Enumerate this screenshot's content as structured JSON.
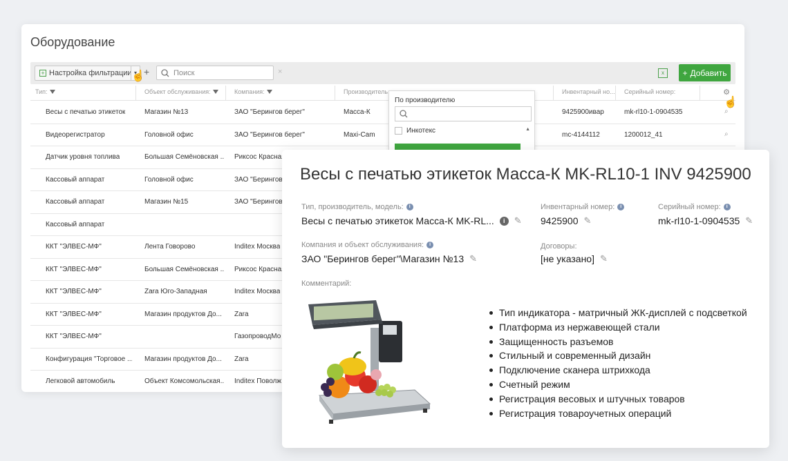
{
  "back": {
    "title": "Оборудование",
    "toolbar": {
      "filter_label": "Настройка фильтрации",
      "drop_glyph": "▾",
      "plus_glyph": "+",
      "search_placeholder": "Поиск",
      "clear_glyph": "×",
      "add_label": "Добавить",
      "add_glyph": "+",
      "excel_glyph": "x"
    },
    "columns": [
      "Тип:",
      "Объект обслуживания:",
      "Компания:",
      "Производитель:",
      "Инвентарный но...",
      "Серийный номер:"
    ],
    "rows": [
      {
        "type": "Весы с печатью этикеток",
        "object": "Магазин №13",
        "company": "ЗАО \"Берингов берег\"",
        "maker": "Масса-К",
        "inv": "9425900ивар",
        "serial": "mk-rl10-1-0904535"
      },
      {
        "type": "Видеорегистратор",
        "object": "Головной офис",
        "company": "ЗАО \"Берингов берег\"",
        "maker": "Maxi-Cam",
        "inv": "mc-4144112",
        "serial": "1200012_41"
      },
      {
        "type": "Датчик уровня топлива",
        "object": "Большая Семёновская ...",
        "company": "Риксос Красная",
        "maker": "",
        "inv": "",
        "serial": ""
      },
      {
        "type": "Кассовый аппарат",
        "object": "Головной офис",
        "company": "ЗАО \"Берингов",
        "maker": "",
        "inv": "",
        "serial": ""
      },
      {
        "type": "Кассовый аппарат",
        "object": "Магазин №15",
        "company": "ЗАО \"Берингов",
        "maker": "",
        "inv": "",
        "serial": ""
      },
      {
        "type": "Кассовый аппарат",
        "object": "",
        "company": "",
        "maker": "",
        "inv": "",
        "serial": ""
      },
      {
        "type": "ККТ \"ЭЛВЕС-МФ\"",
        "object": "Лента Говорово",
        "company": "Inditex Москва",
        "maker": "",
        "inv": "",
        "serial": ""
      },
      {
        "type": "ККТ \"ЭЛВЕС-МФ\"",
        "object": "Большая Семёновская ...",
        "company": "Риксос Красная",
        "maker": "",
        "inv": "",
        "serial": ""
      },
      {
        "type": "ККТ \"ЭЛВЕС-МФ\"",
        "object": "Zara Юго-Западная",
        "company": "Inditex Москва",
        "maker": "",
        "inv": "",
        "serial": ""
      },
      {
        "type": "ККТ \"ЭЛВЕС-МФ\"",
        "object": "Магазин продуктов До...",
        "company": "Zara",
        "maker": "",
        "inv": "",
        "serial": ""
      },
      {
        "type": "ККТ \"ЭЛВЕС-МФ\"",
        "object": "",
        "company": "ГазопроводМо",
        "maker": "",
        "inv": "",
        "serial": ""
      },
      {
        "type": "Конфигурация \"Торговое ...",
        "object": "Магазин продуктов До...",
        "company": "Zara",
        "maker": "",
        "inv": "",
        "serial": ""
      },
      {
        "type": "Легковой автомобиль",
        "object": "Объект Комсомольская...",
        "company": "Inditex Поволж",
        "maker": "",
        "inv": "",
        "serial": ""
      }
    ],
    "dropdown": {
      "title": "По производителю",
      "item": "Инкотекс",
      "scroll_glyph": "▲"
    }
  },
  "front": {
    "title": "Весы с печатью этикеток Масса-К MK-RL10-1 INV 9425900",
    "type_label": "Тип, производитель, модель:",
    "type_value": "Весы с печатью этикеток Масса-К MK-RL...",
    "inv_label": "Инвентарный номер:",
    "inv_value": "9425900",
    "serial_label": "Серийный номер:",
    "serial_value": "mk-rl10-1-0904535",
    "company_label": "Компания и объект обслуживания:",
    "company_value": "ЗАО \"Берингов берег\"\\Магазин №13",
    "contract_label": "Договоры:",
    "contract_value": "[не указано]",
    "comment_label": "Комментарий:",
    "info_glyph": "i",
    "edit_glyph": "✎",
    "features": [
      "Тип индикатора - матричный ЖК-дисплей с подсветкой",
      "Платформа из нержавеющей стали",
      "Защищенность разъемов",
      "Стильный и современный дизайн",
      "Подключение сканера штрихкода",
      "Счетный режим",
      "Регистрация весовых и штучных товаров",
      "Регистрация товароучетных операций"
    ]
  },
  "colors": {
    "accent_green": "#3fa63f",
    "info_blue": "#7a8fb0"
  }
}
